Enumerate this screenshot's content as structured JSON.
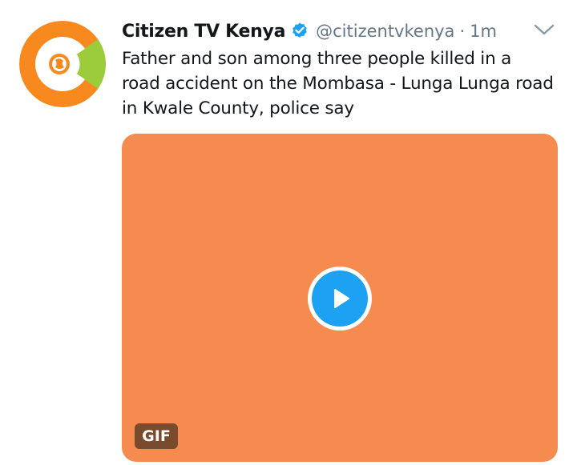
{
  "tweet": {
    "display_name": "Citizen TV Kenya",
    "handle": "@citizentvkenya",
    "separator": "·",
    "timestamp": "1m",
    "text": "Father and son among three people killed in a road accident on the Mombasa - Lunga Lunga road in Kwale County, police say",
    "verified": true
  },
  "media": {
    "badge_label": "GIF",
    "background_color": "#f58b4f",
    "play_icon": "play-icon"
  },
  "icons": {
    "verified": "verified-badge-icon",
    "more": "chevron-down-icon",
    "avatar": "citizen-tv-logo"
  },
  "colors": {
    "accent": "#1da1f2",
    "avatar_orange": "#f7891e",
    "avatar_green": "#9ccb3b",
    "muted_text": "#657786"
  }
}
